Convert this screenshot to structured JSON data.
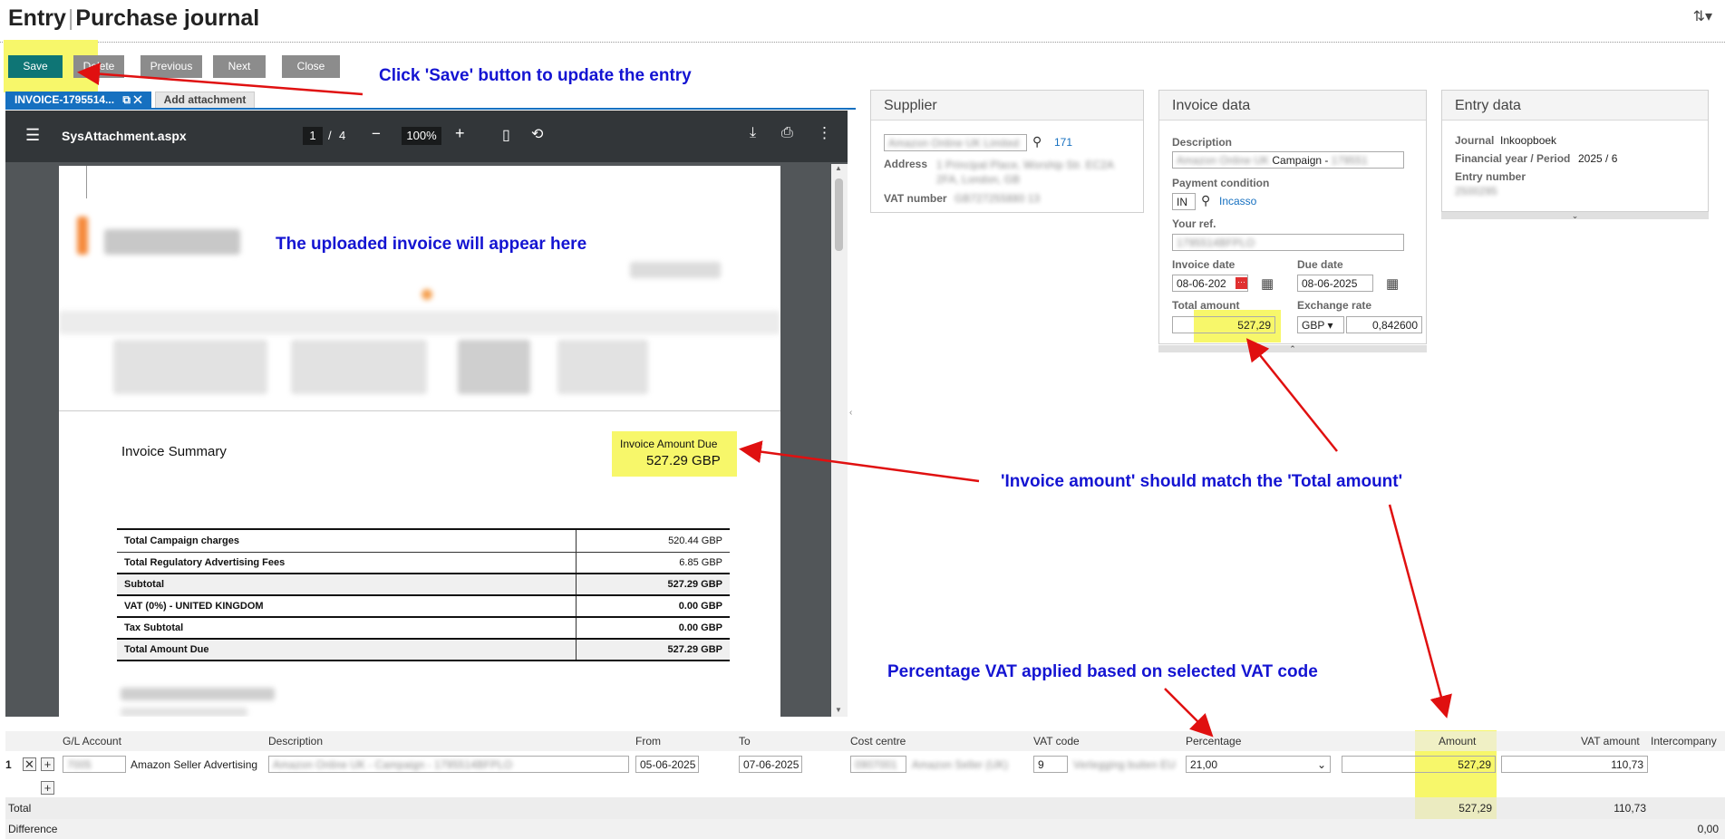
{
  "page": {
    "title_main": "Entry",
    "title_sep": "|",
    "title_sub": "Purchase journal"
  },
  "toolbar": {
    "save": "Save",
    "delete": "Delete",
    "previous": "Previous",
    "next": "Next",
    "close": "Close"
  },
  "annotations": {
    "save": "Click 'Save' button to update the entry",
    "invoice_area": "The uploaded invoice will appear here",
    "amount_match": "'Invoice amount' should match the 'Total amount'",
    "vat": "Percentage VAT applied based on selected VAT code"
  },
  "tabs": {
    "invoice": "INVOICE-1795514...",
    "add_attachment": "Add attachment"
  },
  "viewer": {
    "filename": "SysAttachment.aspx",
    "page_current": "1",
    "page_sep": "/",
    "page_total": "4",
    "zoom": "100%",
    "summary_title": "Invoice Summary",
    "amount_due_label": "Invoice Amount Due",
    "amount_due_value": "527.29 GBP",
    "rows": [
      {
        "label": "Total Campaign charges",
        "value": "520.44 GBP"
      },
      {
        "label": "Total Regulatory Advertising Fees",
        "value": "6.85 GBP"
      },
      {
        "label": "Subtotal",
        "value": "527.29 GBP"
      },
      {
        "label": "VAT (0%) - UNITED KINGDOM",
        "value": "0.00 GBP"
      },
      {
        "label": "Tax Subtotal",
        "value": "0.00 GBP"
      },
      {
        "label": "Total Amount Due",
        "value": "527.29 GBP"
      }
    ]
  },
  "supplier": {
    "header": "Supplier",
    "code": "171",
    "address_label": "Address",
    "vat_label": "VAT number"
  },
  "invoice_data": {
    "header": "Invoice data",
    "description_label": "Description",
    "description_value": "Campaign -",
    "payment_condition_label": "Payment condition",
    "payment_condition_code": "IN",
    "payment_condition_name": "Incasso",
    "your_ref_label": "Your ref.",
    "invoice_date_label": "Invoice date",
    "invoice_date_value": "08-06-202",
    "due_date_label": "Due date",
    "due_date_value": "08-06-2025",
    "total_amount_label": "Total amount",
    "total_amount_value": "527,29",
    "exchange_rate_label": "Exchange rate",
    "currency": "GBP",
    "exchange_rate_value": "0,842600"
  },
  "entry_data": {
    "header": "Entry data",
    "journal_label": "Journal",
    "journal_value": "Inkoopboek",
    "period_label": "Financial year / Period",
    "period_value": "2025 / 6",
    "entry_number_label": "Entry number"
  },
  "grid": {
    "headers": {
      "gl_account": "G/L Account",
      "description": "Description",
      "from": "From",
      "to": "To",
      "cost_centre": "Cost centre",
      "vat_code": "VAT code",
      "percentage": "Percentage",
      "amount": "Amount",
      "vat_amount": "VAT amount",
      "intercompany": "Intercompany"
    },
    "row": {
      "index": "1",
      "gl_name": "Amazon Seller Advertising",
      "from": "05-06-2025",
      "to": "07-06-2025",
      "vat_code": "9",
      "percentage": "21,00",
      "amount": "527,29",
      "vat_amount": "110,73"
    },
    "total_label": "Total",
    "total_amount": "527,29",
    "total_vat": "110,73",
    "difference_label": "Difference",
    "difference_value": "0,00"
  },
  "colors": {
    "accent": "#1670c0",
    "save": "#0e7575",
    "highlight": "#f7f76a",
    "annotation": "#1414d2",
    "arrow": "#e01010"
  }
}
